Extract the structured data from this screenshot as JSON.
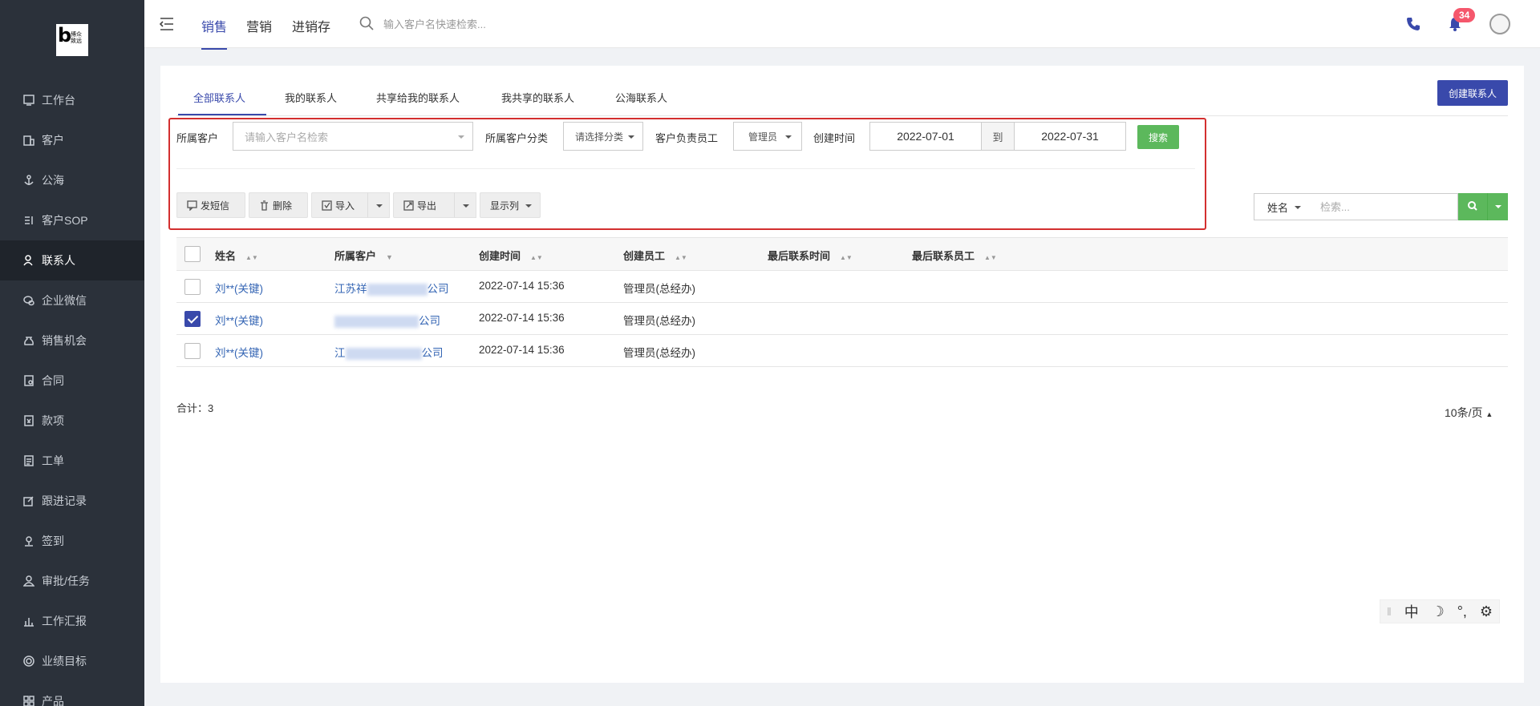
{
  "logo": {
    "letter": "b",
    "name_line1": "博众",
    "name_line2": "致远"
  },
  "sidebar": {
    "items": [
      {
        "label": "工作台",
        "icon": "monitor-icon"
      },
      {
        "label": "客户",
        "icon": "building-icon"
      },
      {
        "label": "公海",
        "icon": "anchor-icon"
      },
      {
        "label": "客户SOP",
        "icon": "sop-icon"
      },
      {
        "label": "联系人",
        "icon": "contact-icon",
        "active": true
      },
      {
        "label": "企业微信",
        "icon": "wechat-icon"
      },
      {
        "label": "销售机会",
        "icon": "money-bag-icon"
      },
      {
        "label": "合同",
        "icon": "contract-icon"
      },
      {
        "label": "款项",
        "icon": "payment-icon"
      },
      {
        "label": "工单",
        "icon": "work-order-icon"
      },
      {
        "label": "跟进记录",
        "icon": "edit-icon"
      },
      {
        "label": "签到",
        "icon": "location-icon"
      },
      {
        "label": "审批/任务",
        "icon": "user-task-icon"
      },
      {
        "label": "工作汇报",
        "icon": "report-icon"
      },
      {
        "label": "业绩目标",
        "icon": "target-icon"
      },
      {
        "label": "产品",
        "icon": "product-icon"
      }
    ]
  },
  "topbar": {
    "tabs": [
      "销售",
      "营销",
      "进销存"
    ],
    "search_placeholder": "输入客户名快速检索...",
    "notification_count": "34"
  },
  "subtabs": [
    "全部联系人",
    "我的联系人",
    "共享给我的联系人",
    "我共享的联系人",
    "公海联系人"
  ],
  "create_button": "创建联系人",
  "filters": {
    "customer_label": "所属客户",
    "customer_placeholder": "请输入客户名检索",
    "category_label": "所属客户分类",
    "category_value": "请选择分类",
    "employee_label": "客户负责员工",
    "employee_value": "管理员",
    "date_label": "创建时间",
    "date_from": "2022-07-01",
    "date_to_label": "到",
    "date_to": "2022-07-31",
    "search_button": "搜索"
  },
  "actions": {
    "sms": "发短信",
    "delete": "删除",
    "import": "导入",
    "export": "导出",
    "columns": "显示列"
  },
  "list_search": {
    "field": "姓名",
    "placeholder": "检索..."
  },
  "table": {
    "headers": [
      "姓名",
      "所属客户",
      "创建时间",
      "创建员工",
      "最后联系时间",
      "最后联系员工"
    ],
    "rows": [
      {
        "name": "刘**(关键)",
        "cust_prefix": "江苏祥",
        "cust_suffix": "公司",
        "created": "2022-07-14 15:36",
        "employee": "管理员(总经办)",
        "checked": false
      },
      {
        "name": "刘**(关键)",
        "cust_prefix": "",
        "cust_suffix": "公司",
        "created": "2022-07-14 15:36",
        "employee": "管理员(总经办)",
        "checked": true
      },
      {
        "name": "刘**(关键)",
        "cust_prefix": "江",
        "cust_suffix": "公司",
        "created": "2022-07-14 15:36",
        "employee": "管理员(总经办)",
        "checked": false
      }
    ]
  },
  "footer": {
    "total": "合计：3",
    "page_size": "10条/页"
  },
  "ime": [
    "中",
    "☽",
    "°,",
    "⚙"
  ],
  "colors": {
    "primary": "#3949ab",
    "success": "#5cb85c",
    "sidebar": "#2b313a",
    "highlight": "#d32f2f",
    "badge": "#f5576c"
  }
}
